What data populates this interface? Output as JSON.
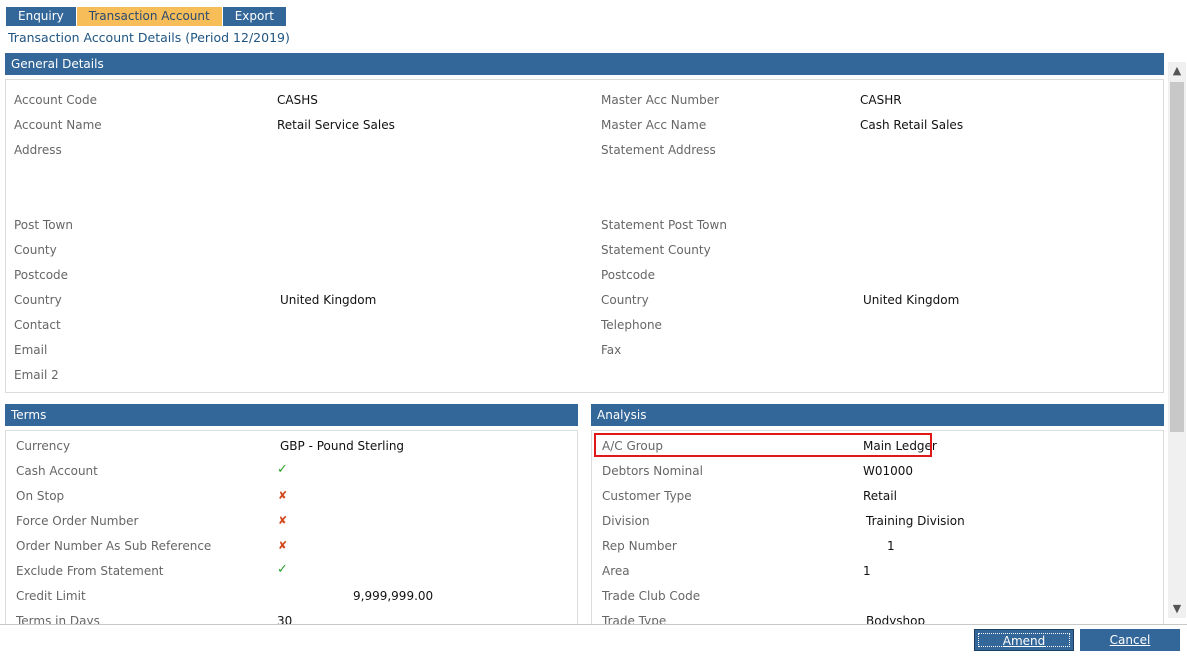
{
  "tabs": [
    "Enquiry",
    "Transaction Account",
    "Export"
  ],
  "page_title": "Transaction Account Details (Period 12/2019)",
  "general": {
    "header": "General Details",
    "left": [
      {
        "label": "Account Code",
        "value": "CASHS"
      },
      {
        "label": "Account Name",
        "value": "Retail Service Sales"
      },
      {
        "label": "Address",
        "value": ""
      },
      {
        "label": "Post Town",
        "value": ""
      },
      {
        "label": "County",
        "value": ""
      },
      {
        "label": "Postcode",
        "value": ""
      },
      {
        "label": "Country",
        "value": "United Kingdom"
      },
      {
        "label": "Contact",
        "value": ""
      },
      {
        "label": "Email",
        "value": ""
      },
      {
        "label": "Email 2",
        "value": ""
      }
    ],
    "right": [
      {
        "label": "Master Acc Number",
        "value": "CASHR"
      },
      {
        "label": "Master Acc Name",
        "value": "Cash Retail Sales"
      },
      {
        "label": "Statement Address",
        "value": ""
      },
      {
        "label": "Statement Post Town",
        "value": ""
      },
      {
        "label": "Statement County",
        "value": ""
      },
      {
        "label": "Postcode",
        "value": ""
      },
      {
        "label": "Country",
        "value": "United Kingdom"
      },
      {
        "label": "Telephone",
        "value": ""
      },
      {
        "label": "Fax",
        "value": ""
      }
    ]
  },
  "terms": {
    "header": "Terms",
    "rows": [
      {
        "label": "Currency",
        "value": "GBP - Pound Sterling"
      },
      {
        "label": "Cash Account",
        "value": "✓"
      },
      {
        "label": "On Stop",
        "value": "✘"
      },
      {
        "label": "Force Order Number",
        "value": "✘"
      },
      {
        "label": "Order Number As Sub Reference",
        "value": "✘"
      },
      {
        "label": "Exclude From Statement",
        "value": "✓"
      },
      {
        "label": "Credit Limit",
        "value": "9,999,999.00"
      },
      {
        "label": "Terms in Days",
        "value": "30"
      }
    ]
  },
  "analysis": {
    "header": "Analysis",
    "rows": [
      {
        "label": "A/C Group",
        "value": "Main Ledger"
      },
      {
        "label": "Debtors Nominal",
        "value": "W01000"
      },
      {
        "label": "Customer Type",
        "value": "Retail"
      },
      {
        "label": "Division",
        "value": "Training Division"
      },
      {
        "label": "Rep Number",
        "value": "1"
      },
      {
        "label": "Area",
        "value": "1"
      },
      {
        "label": "Trade Club Code",
        "value": ""
      },
      {
        "label": "Trade Type",
        "value": "Bodyshop"
      }
    ]
  },
  "buttons": {
    "amend": "Amend",
    "cancel": "Cancel"
  },
  "icons": {
    "check": "check-icon",
    "cross": "cross-icon",
    "scroll_up": "chevron-up-icon",
    "scroll_down": "chevron-down-icon"
  },
  "colors": {
    "header": "#336699",
    "active_tab": "#f6bd59",
    "check": "#2aa12a",
    "cross": "#d24a1c",
    "highlight": "#e01818"
  }
}
